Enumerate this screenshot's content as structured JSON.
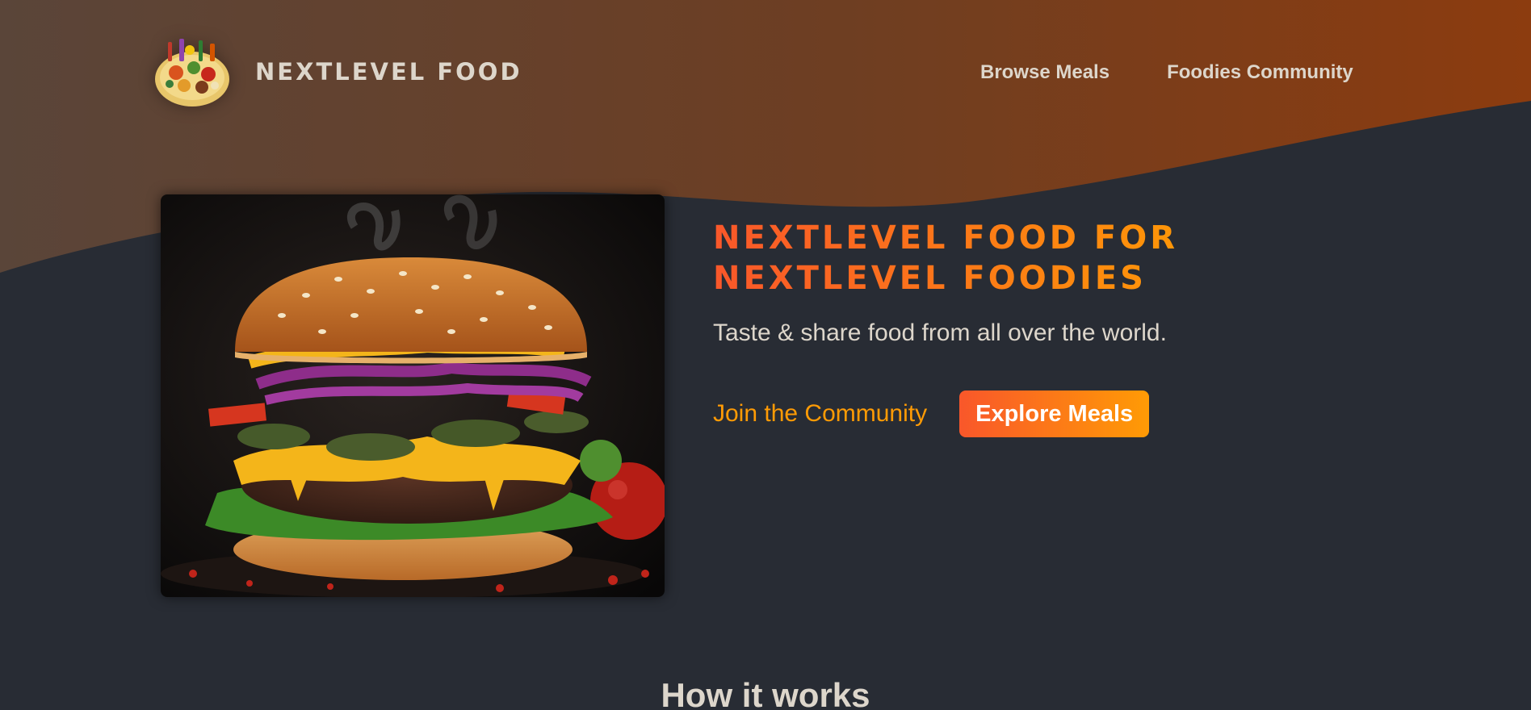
{
  "header": {
    "logo_text": "NEXTLEVEL FOOD",
    "nav": [
      {
        "label": "Browse Meals"
      },
      {
        "label": "Foodies Community"
      }
    ]
  },
  "hero": {
    "title": "NEXTLEVEL FOOD FOR NEXTLEVEL FOODIES",
    "subtitle": "Taste & share food from all over the world.",
    "join_label": "Join the Community",
    "explore_label": "Explore Meals"
  },
  "how_it_works": {
    "heading": "How it works"
  },
  "icons": {
    "logo": "food-platter-icon",
    "hero_image": "burger-image"
  },
  "colors": {
    "background": "#282c34",
    "header_gradient_start": "#5a4539",
    "header_gradient_end": "#8a3d12",
    "accent_start": "#f9572a",
    "accent_end": "#ff9b05",
    "text": "#ddd6cb"
  }
}
